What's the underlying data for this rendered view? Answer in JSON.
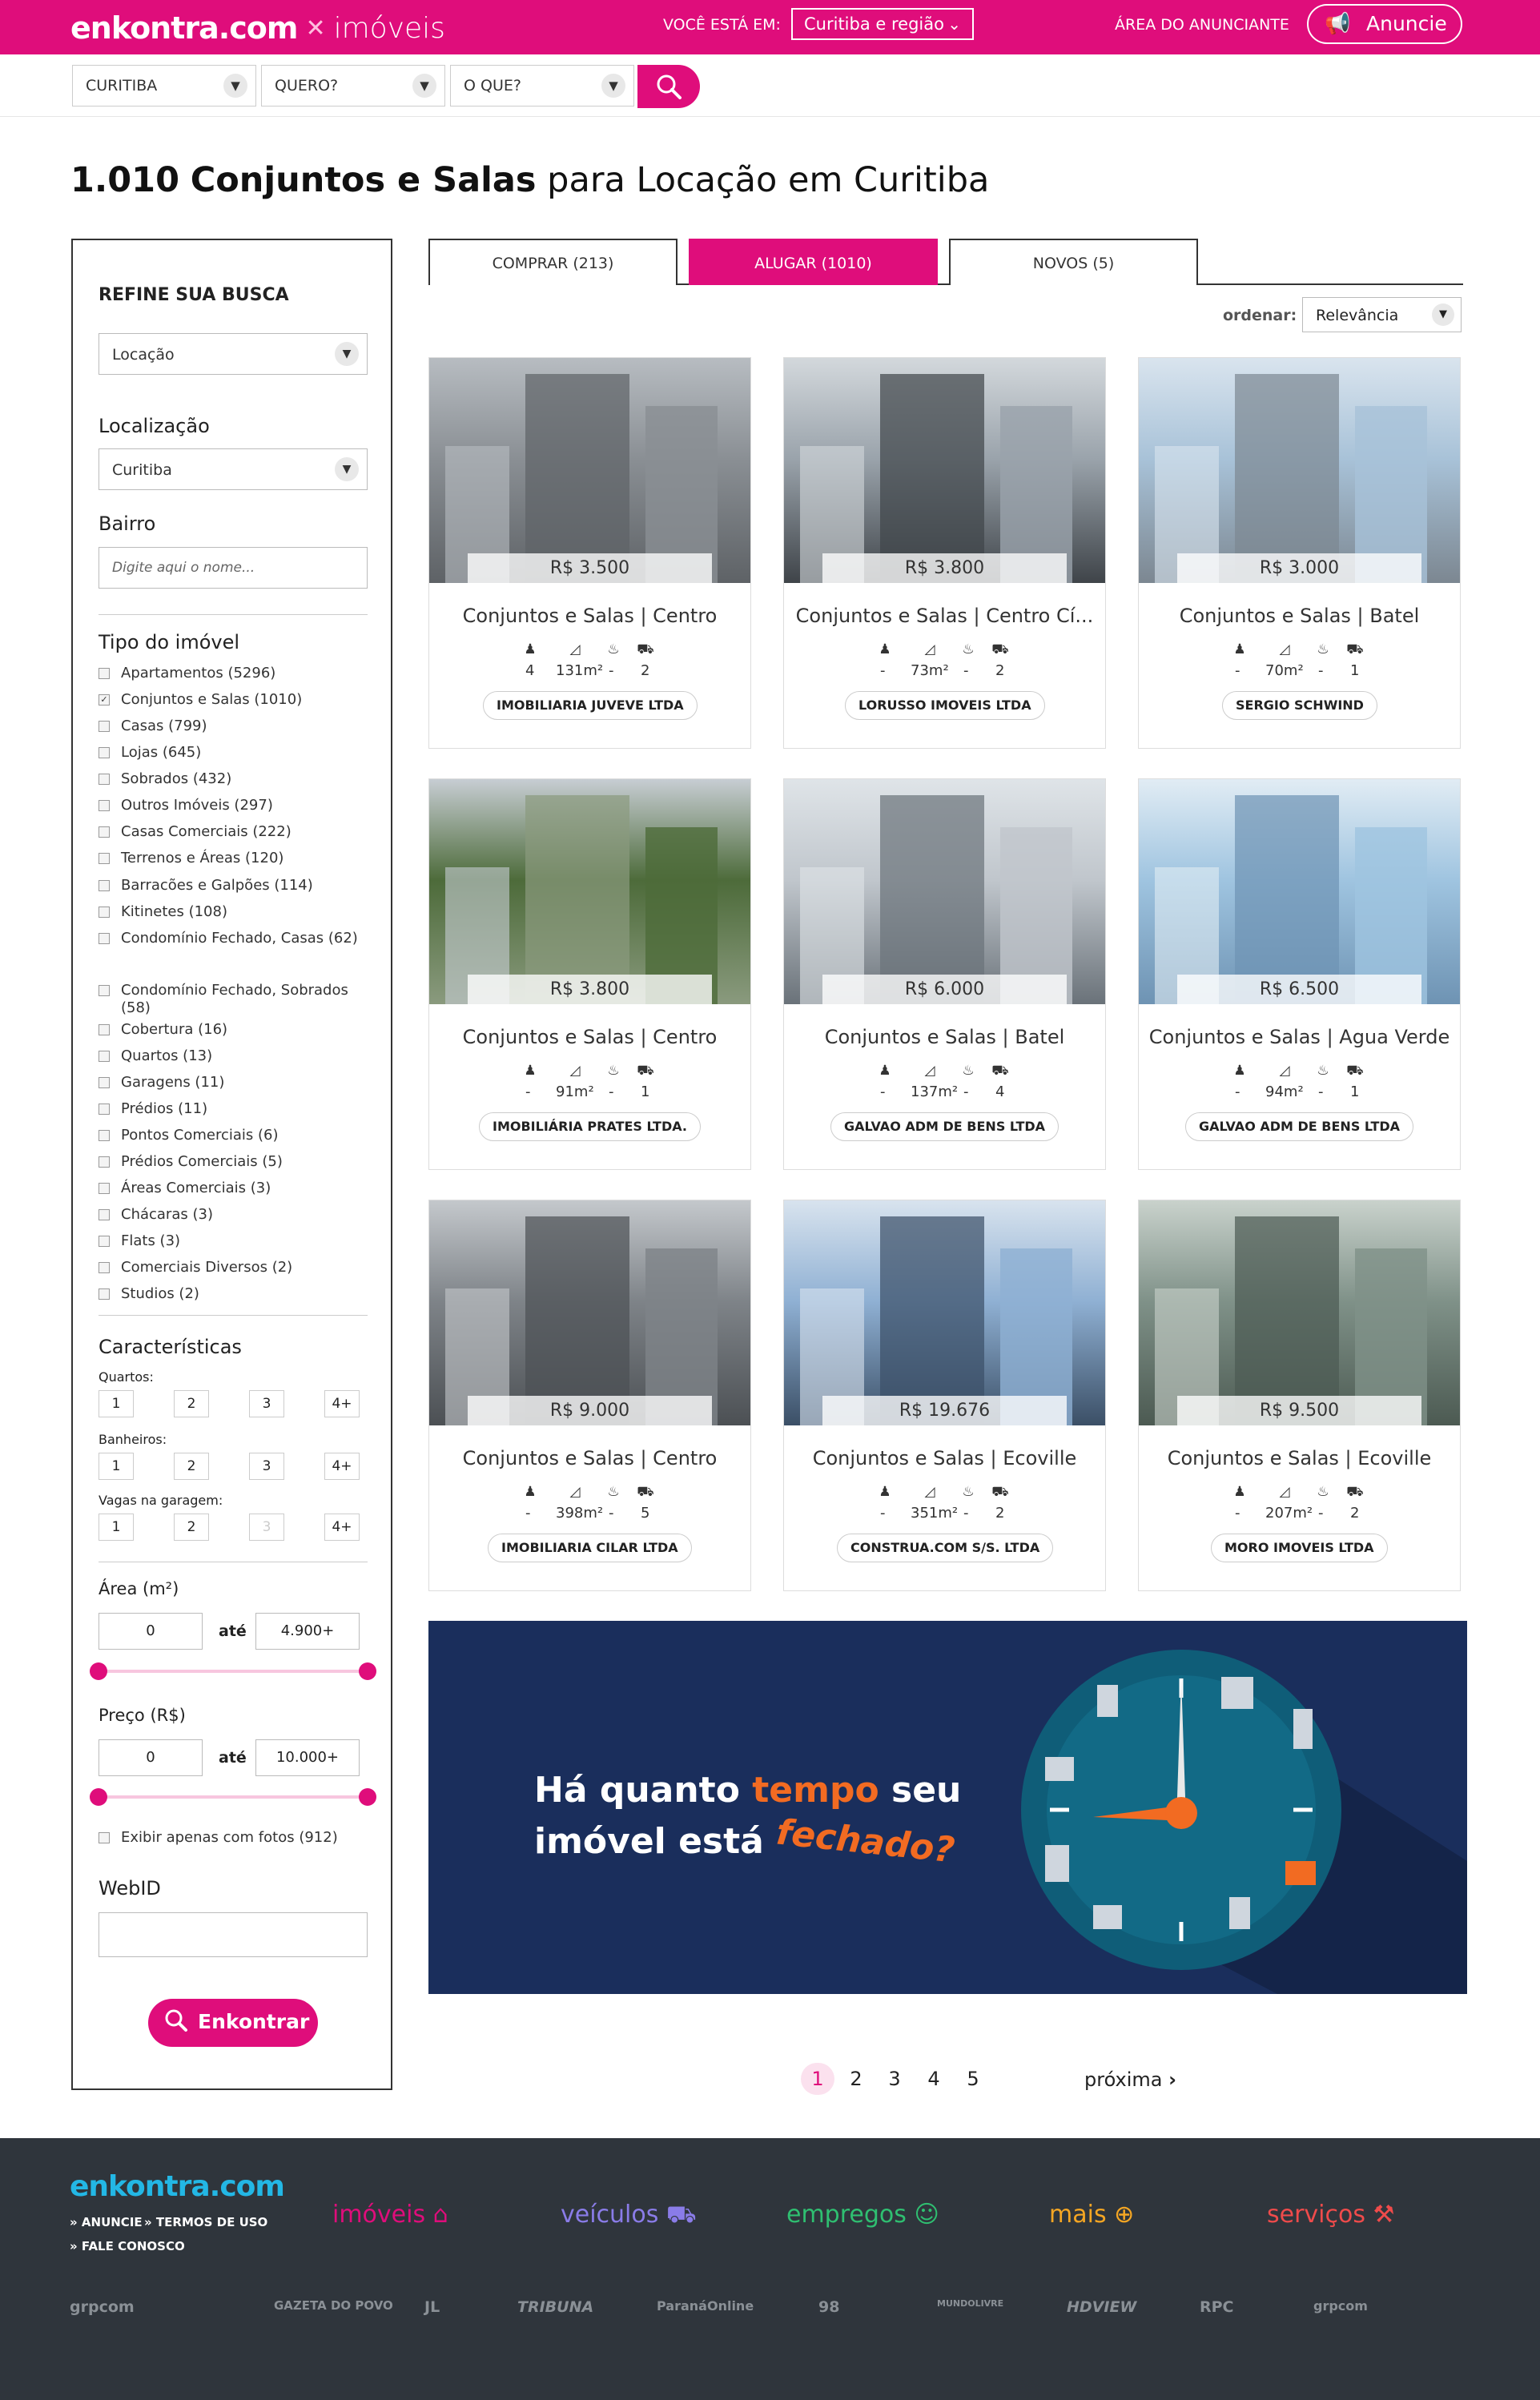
{
  "header": {
    "brand": "enkontra.com",
    "brand_sub": "imóveis",
    "where_label": "VOCÊ ESTÁ EM:",
    "region_value": "Curitiba e região",
    "advertiser_area": "ÁREA DO ANUNCIANTE",
    "announce_button": "Anuncie",
    "accent_color": "#df0d7b"
  },
  "search": {
    "city": "CURITIBA",
    "want": "QUERO?",
    "what": "O QUE?"
  },
  "title": {
    "count": "1.010",
    "category": "Conjuntos e Salas",
    "rest": "para Locação em Curitiba"
  },
  "refine": {
    "heading": "REFINE SUA BUSCA",
    "mode_value": "Locação",
    "location_label": "Localização",
    "location_value": "Curitiba",
    "bairro_label": "Bairro",
    "bairro_placeholder": "Digite aqui o nome...",
    "type_label": "Tipo do imóvel",
    "types": [
      {
        "label": "Apartamentos (5296)",
        "checked": false
      },
      {
        "label": "Conjuntos e Salas (1010)",
        "checked": true
      },
      {
        "label": "Casas (799)",
        "checked": false
      },
      {
        "label": "Lojas (645)",
        "checked": false
      },
      {
        "label": "Sobrados (432)",
        "checked": false
      },
      {
        "label": "Outros Imóveis (297)",
        "checked": false
      },
      {
        "label": "Casas Comerciais (222)",
        "checked": false
      },
      {
        "label": "Terrenos e Áreas (120)",
        "checked": false
      },
      {
        "label": "Barracões e Galpões (114)",
        "checked": false
      },
      {
        "label": "Kitinetes (108)",
        "checked": false
      },
      {
        "label": "Condomínio Fechado, Casas (62)",
        "checked": false
      },
      {
        "label": "Condomínio Fechado, Sobrados (58)",
        "checked": false
      },
      {
        "label": "Cobertura (16)",
        "checked": false
      },
      {
        "label": "Quartos (13)",
        "checked": false
      },
      {
        "label": "Garagens (11)",
        "checked": false
      },
      {
        "label": "Prédios (11)",
        "checked": false
      },
      {
        "label": "Pontos Comerciais (6)",
        "checked": false
      },
      {
        "label": "Prédios Comerciais (5)",
        "checked": false
      },
      {
        "label": "Áreas Comerciais (3)",
        "checked": false
      },
      {
        "label": "Chácaras (3)",
        "checked": false
      },
      {
        "label": "Flats (3)",
        "checked": false
      },
      {
        "label": "Comerciais Diversos (2)",
        "checked": false
      },
      {
        "label": "Studios (2)",
        "checked": false
      }
    ],
    "features_label": "Características",
    "quartos_label": "Quartos:",
    "banheiros_label": "Banheiros:",
    "vagas_label": "Vagas na garagem:",
    "opt1": "1",
    "opt2": "2",
    "opt3": "3",
    "opt4": "4+",
    "area_label": "Área (m²)",
    "area_min": "0",
    "area_max": "4.900+",
    "ate": "até",
    "price_label": "Preço (R$)",
    "price_min": "0",
    "price_max": "10.000+",
    "photos_only": "Exibir apenas com fotos (912)",
    "webid_label": "WebID",
    "submit": "Enkontrar"
  },
  "tabs": [
    {
      "label": "COMPRAR (213)",
      "active": false
    },
    {
      "label": "ALUGAR (1010)",
      "active": true
    },
    {
      "label": "NOVOS (5)",
      "active": false
    }
  ],
  "order": {
    "label": "ordenar:",
    "value": "Relevância"
  },
  "listings": [
    {
      "price": "R$ 3.500",
      "title": "Conjuntos e Salas | Centro",
      "rooms": "4",
      "area": "131m²",
      "baths": "-",
      "parking": "2",
      "agent": "IMOBILIARIA JUVEVE LTDA"
    },
    {
      "price": "R$ 3.800",
      "title": "Conjuntos e Salas | Centro Cí...",
      "rooms": "-",
      "area": "73m²",
      "baths": "-",
      "parking": "2",
      "agent": "LORUSSO IMOVEIS LTDA"
    },
    {
      "price": "R$ 3.000",
      "title": "Conjuntos e Salas | Batel",
      "rooms": "-",
      "area": "70m²",
      "baths": "-",
      "parking": "1",
      "agent": "SERGIO SCHWIND"
    },
    {
      "price": "R$ 3.800",
      "title": "Conjuntos e Salas | Centro",
      "rooms": "-",
      "area": "91m²",
      "baths": "-",
      "parking": "1",
      "agent": "IMOBILIÁRIA PRATES LTDA."
    },
    {
      "price": "R$ 6.000",
      "title": "Conjuntos e Salas | Batel",
      "rooms": "-",
      "area": "137m²",
      "baths": "-",
      "parking": "4",
      "agent": "GALVAO ADM DE BENS LTDA"
    },
    {
      "price": "R$ 6.500",
      "title": "Conjuntos e Salas | Agua Verde",
      "rooms": "-",
      "area": "94m²",
      "baths": "-",
      "parking": "1",
      "agent": "GALVAO ADM DE BENS LTDA"
    },
    {
      "price": "R$ 9.000",
      "title": "Conjuntos e Salas | Centro",
      "rooms": "-",
      "area": "398m²",
      "baths": "-",
      "parking": "5",
      "agent": "IMOBILIARIA CILAR LTDA"
    },
    {
      "price": "R$ 19.676",
      "title": "Conjuntos e Salas | Ecoville",
      "rooms": "-",
      "area": "351m²",
      "baths": "-",
      "parking": "2",
      "agent": "CONSTRUA.COM S/S. LTDA"
    },
    {
      "price": "R$ 9.500",
      "title": "Conjuntos e Salas | Ecoville",
      "rooms": "-",
      "area": "207m²",
      "baths": "-",
      "parking": "2",
      "agent": "MORO IMOVEIS LTDA"
    }
  ],
  "banner": {
    "line1_a": "Há quanto ",
    "line1_b": "tempo",
    "line1_c": " seu",
    "line2_a": "imóvel está ",
    "line2_b": "fechado?"
  },
  "pagination": {
    "pages": [
      "1",
      "2",
      "3",
      "4",
      "5"
    ],
    "current": "1",
    "next": "próxima"
  },
  "footer": {
    "brand": "enkontra.com",
    "link_anuncie": "» ANUNCIE",
    "link_termos": "» TERMOS DE USO",
    "link_fale": "» FALE CONOSCO",
    "categories": [
      "imóveis",
      "veículos",
      "empregos",
      "mais",
      "serviços"
    ],
    "partners": [
      "grpcom",
      "GAZETA DO POVO",
      "JL",
      "TRIBUNA",
      "ParanáOnline",
      "98",
      "MUNDOLIVRE",
      "HDVIEW",
      "RPC",
      "grpcom"
    ]
  }
}
